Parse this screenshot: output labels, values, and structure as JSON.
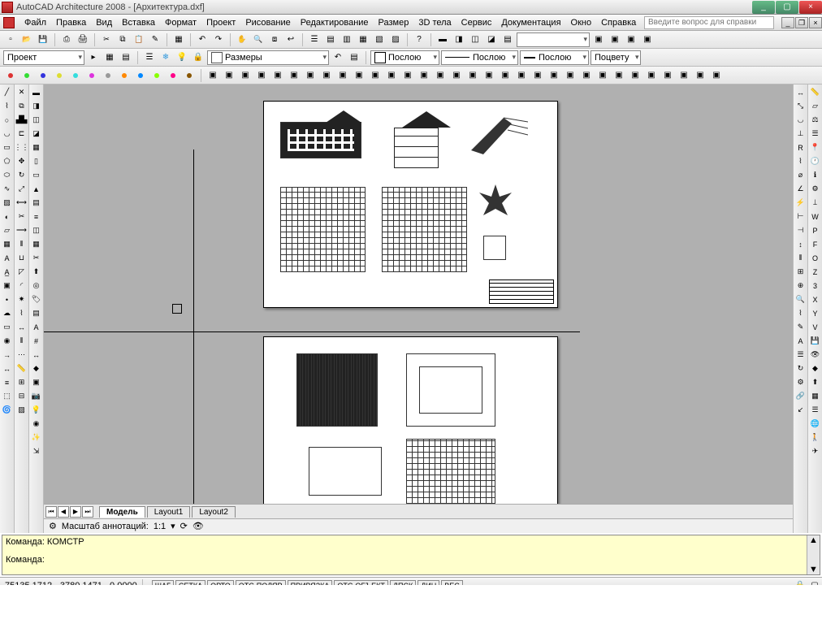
{
  "title": "AutoCAD Architecture 2008 - [Архитектура.dxf]",
  "menu": [
    "Файл",
    "Правка",
    "Вид",
    "Вставка",
    "Формат",
    "Проект",
    "Рисование",
    "Редактирование",
    "Размер",
    "3D тела",
    "Сервис",
    "Документация",
    "Окно",
    "Справка"
  ],
  "help_search_placeholder": "Введите вопрос для справки",
  "toolrow2": {
    "project_dd": "Проект",
    "dims_dd": "Размеры",
    "bylayer1": "Послою",
    "bylayer2": "Послою",
    "bylayer3": "Послою",
    "bycolor": "Поцвету"
  },
  "tabs": {
    "nav": [
      "⏮",
      "◀",
      "▶",
      "⏭"
    ],
    "items": [
      "Модель",
      "Layout1",
      "Layout2"
    ],
    "active": 0
  },
  "annoscale": {
    "label": "Масштаб аннотаций:",
    "value": "1:1"
  },
  "cmd": {
    "line1": "Команда: КОМСТР",
    "line2": "Команда:"
  },
  "status": {
    "coords": "75135.1712, -3780.1471 , 0.0000",
    "toggles": [
      "ШАГ",
      "СЕТКА",
      "ОРТО",
      "ОТС-ПОЛЯР",
      "ПРИВЯЗКА",
      "ОТС-ОБЪЕКТ",
      "ДПСК",
      "ДИН",
      "ВЕС"
    ]
  }
}
